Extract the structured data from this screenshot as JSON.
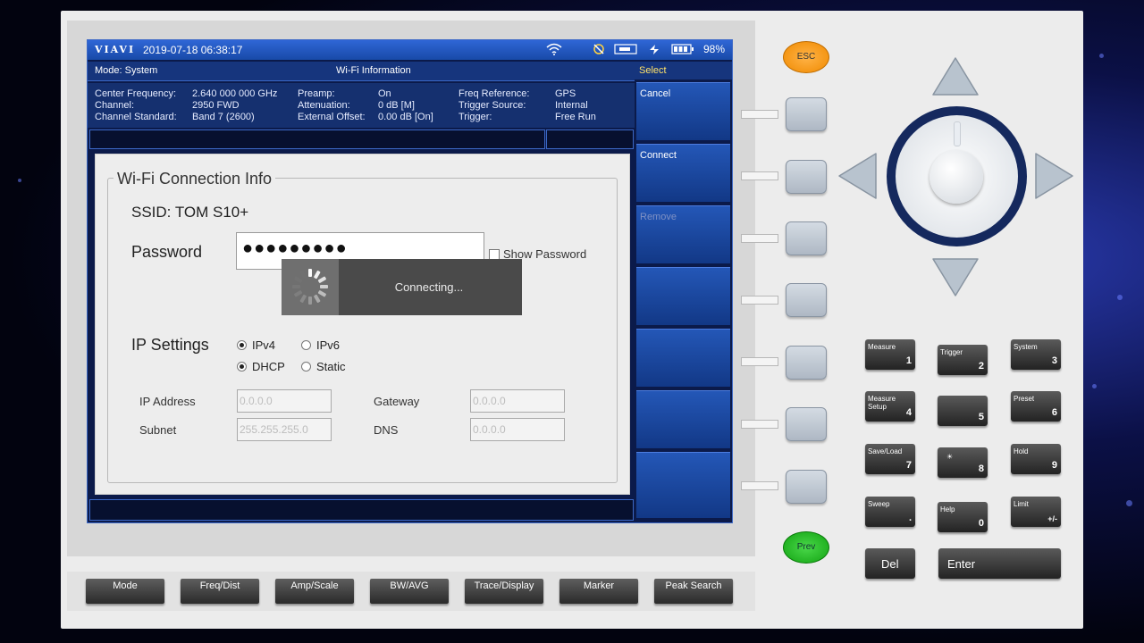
{
  "status_bar": {
    "brand": "VIAVI",
    "datetime": "2019-07-18  06:38:17",
    "battery": "98%",
    "icons": [
      "wifi-icon",
      "gps-off-icon",
      "usb-icon",
      "power-plug-icon",
      "battery-icon"
    ]
  },
  "mode_bar": {
    "mode": "Mode: System",
    "title": "Wi-Fi Information"
  },
  "info": {
    "col1_labels": [
      "Center Frequency:",
      "Channel:",
      "Channel Standard:"
    ],
    "col1_values": [
      "2.640 000 000 GHz",
      "2950 FWD",
      "Band 7 (2600)"
    ],
    "col2_labels": [
      "Preamp:",
      "Attenuation:",
      "External Offset:"
    ],
    "col2_values": [
      "On",
      "0 dB [M]",
      "0.00 dB [On]"
    ],
    "col3_labels": [
      "Freq Reference:",
      "Trigger Source:",
      "Trigger:"
    ],
    "col3_values": [
      "GPS",
      "Internal",
      "Free Run"
    ]
  },
  "softkeys": {
    "header": "Select",
    "items": [
      "Cancel",
      "Connect",
      "Remove",
      "",
      "",
      "",
      ""
    ]
  },
  "dialog": {
    "group_title": "Wi-Fi Connection Info",
    "ssid": "SSID: TOM S10+",
    "password_label": "Password",
    "password_value": "●●●●●●●●●",
    "show_password": "Show Password",
    "ip_settings_label": "IP Settings",
    "ipv4": "IPv4",
    "ipv6": "IPv6",
    "dhcp": "DHCP",
    "static": "Static",
    "ip_address_label": "IP Address",
    "ip_address": "0.0.0.0",
    "gateway_label": "Gateway",
    "gateway": "0.0.0.0",
    "subnet_label": "Subnet",
    "subnet": "255.255.255.0",
    "dns_label": "DNS",
    "dns": "0.0.0.0"
  },
  "toast": {
    "text": "Connecting..."
  },
  "panel": {
    "esc": "ESC",
    "prev": "Prev"
  },
  "keypad": {
    "k1": {
      "label": "Measure",
      "num": "1"
    },
    "k2": {
      "label": "Trigger",
      "num": "2"
    },
    "k3": {
      "label": "System",
      "num": "3"
    },
    "k4": {
      "label": "Measure Setup",
      "num": "4"
    },
    "k5": {
      "label": "",
      "num": "5"
    },
    "k6": {
      "label": "Preset",
      "num": "6"
    },
    "k7": {
      "label": "Save/Load",
      "num": "7"
    },
    "k8": {
      "label": "",
      "num": "8"
    },
    "k9": {
      "label": "Hold",
      "num": "9"
    },
    "kdot": {
      "label": "Sweep",
      "num": "."
    },
    "k0": {
      "label": "Help",
      "num": "0"
    },
    "kpm": {
      "label": "Limit",
      "num": "+/-"
    },
    "del": "Del",
    "enter": "Enter"
  },
  "hardkeys": [
    "Mode",
    "Freq/Dist",
    "Amp/Scale",
    "BW/AVG",
    "Trace/Display",
    "Marker",
    "Peak Search"
  ]
}
